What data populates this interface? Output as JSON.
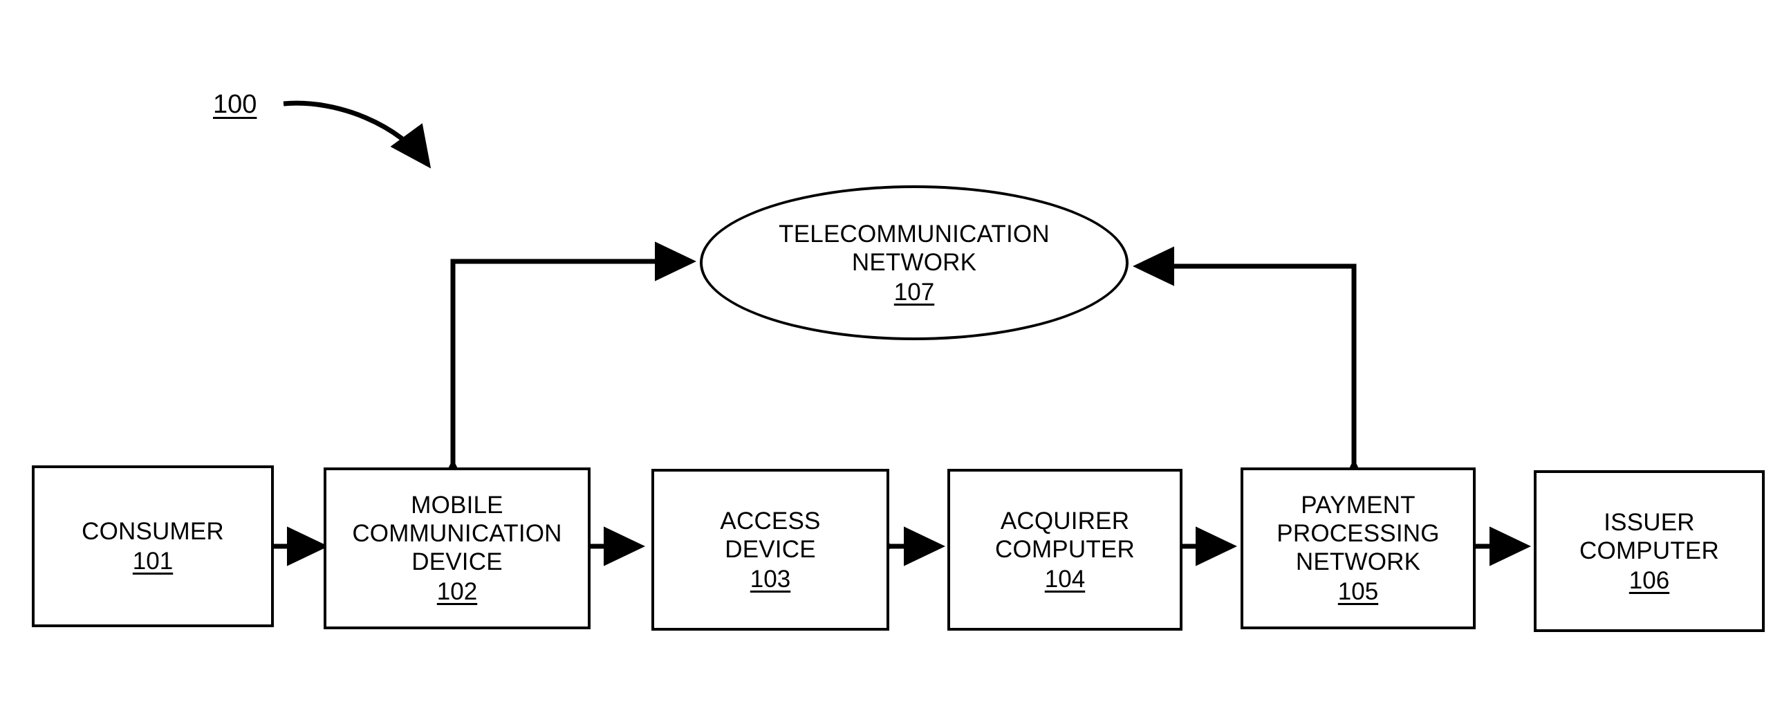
{
  "figure": {
    "number_label": "100",
    "background_color": "#ffffff",
    "line_color": "#000000"
  },
  "nodes": [
    {
      "id": "consumer",
      "shape": "rectangle",
      "lines": [
        "CONSUMER"
      ],
      "ref": "101"
    },
    {
      "id": "mobile-communication-device",
      "shape": "rectangle",
      "lines": [
        "MOBILE",
        "COMMUNICATION",
        "DEVICE"
      ],
      "ref": "102"
    },
    {
      "id": "access-device",
      "shape": "rectangle",
      "lines": [
        "ACCESS",
        "DEVICE"
      ],
      "ref": "103"
    },
    {
      "id": "acquirer-computer",
      "shape": "rectangle",
      "lines": [
        "ACQUIRER",
        "COMPUTER"
      ],
      "ref": "104"
    },
    {
      "id": "payment-processing-network",
      "shape": "rectangle",
      "lines": [
        "PAYMENT",
        "PROCESSING",
        "NETWORK"
      ],
      "ref": "105"
    },
    {
      "id": "issuer-computer",
      "shape": "rectangle",
      "lines": [
        "ISSUER",
        "COMPUTER"
      ],
      "ref": "106"
    },
    {
      "id": "telecommunication-network",
      "shape": "ellipse",
      "lines": [
        "TELECOMMUNICATION",
        "NETWORK"
      ],
      "ref": "107"
    }
  ],
  "connections": [
    {
      "from": "consumer",
      "to": "mobile-communication-device",
      "style": "double-arrow-horizontal"
    },
    {
      "from": "mobile-communication-device",
      "to": "access-device",
      "style": "double-arrow-horizontal"
    },
    {
      "from": "access-device",
      "to": "acquirer-computer",
      "style": "double-arrow-horizontal"
    },
    {
      "from": "acquirer-computer",
      "to": "payment-processing-network",
      "style": "double-arrow-horizontal"
    },
    {
      "from": "payment-processing-network",
      "to": "issuer-computer",
      "style": "double-arrow-horizontal"
    },
    {
      "from": "mobile-communication-device",
      "to": "telecommunication-network",
      "style": "elbow-double-arrow"
    },
    {
      "from": "payment-processing-network",
      "to": "telecommunication-network",
      "style": "elbow-double-arrow"
    }
  ]
}
